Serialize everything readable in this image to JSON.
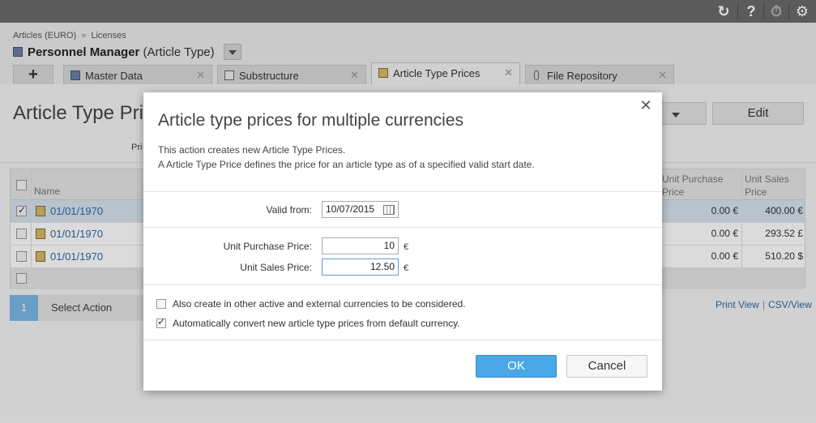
{
  "topbar": {
    "icons": [
      "sync-icon",
      "help-icon",
      "timer-icon",
      "gear-icon"
    ],
    "glyphs": [
      "↻",
      "?",
      "⏱",
      "⚙"
    ]
  },
  "header": {
    "breadcrumb": [
      "Articles (EURO)",
      "Licenses"
    ],
    "breadcrumb_sep": "»",
    "title_bold": "Personnel Manager",
    "title_rest": " (Article Type)"
  },
  "tabs": {
    "add_label": "+",
    "items": [
      {
        "label": "Master Data",
        "icon": "cube-icon"
      },
      {
        "label": "Substructure",
        "icon": "substructure-icon"
      },
      {
        "label": "Article Type Prices",
        "icon": "price-icon"
      },
      {
        "label": "File Repository",
        "icon": "paperclip-icon"
      }
    ],
    "close_glyph": "✕"
  },
  "content": {
    "title": "Article Type Pric",
    "prices_label": "Pri",
    "view_label": "v",
    "edit_label": "Edit",
    "columns": {
      "name": "Name",
      "unit_purchase": "Unit Purchase Price",
      "unit_sales": "Unit Sales Price"
    },
    "rows": [
      {
        "date": "01/01/1970",
        "purchase": "0.00 €",
        "sales": "400.00 €",
        "selected": true
      },
      {
        "date": "01/01/1970",
        "purchase": "0.00 €",
        "sales": "293.52 £",
        "selected": false
      },
      {
        "date": "01/01/1970",
        "purchase": "0.00 €",
        "sales": "510.20 $",
        "selected": false
      }
    ],
    "step_number": "1",
    "step_label": "Select Action",
    "print_view": "Print View",
    "csv_view": "CSV/View"
  },
  "dialog": {
    "title": "Article type prices for multiple currencies",
    "desc_line1": "This action creates new Article Type Prices.",
    "desc_line2": "A Article Type Price defines the price for an article type as of a specified valid start date.",
    "valid_from_label": "Valid from:",
    "valid_from_value": "10/07/2015",
    "unit_purchase_label": "Unit Purchase Price:",
    "unit_purchase_value": "10",
    "unit_sales_label": "Unit Sales Price:",
    "unit_sales_value": "12.50",
    "currency_symbol": "€",
    "option1_label": "Also create in other active and external currencies to be considered.",
    "option1_checked": false,
    "option2_label": "Automatically convert new article type prices from default currency.",
    "option2_checked": true,
    "ok_label": "OK",
    "cancel_label": "Cancel",
    "close_glyph": "✕"
  }
}
